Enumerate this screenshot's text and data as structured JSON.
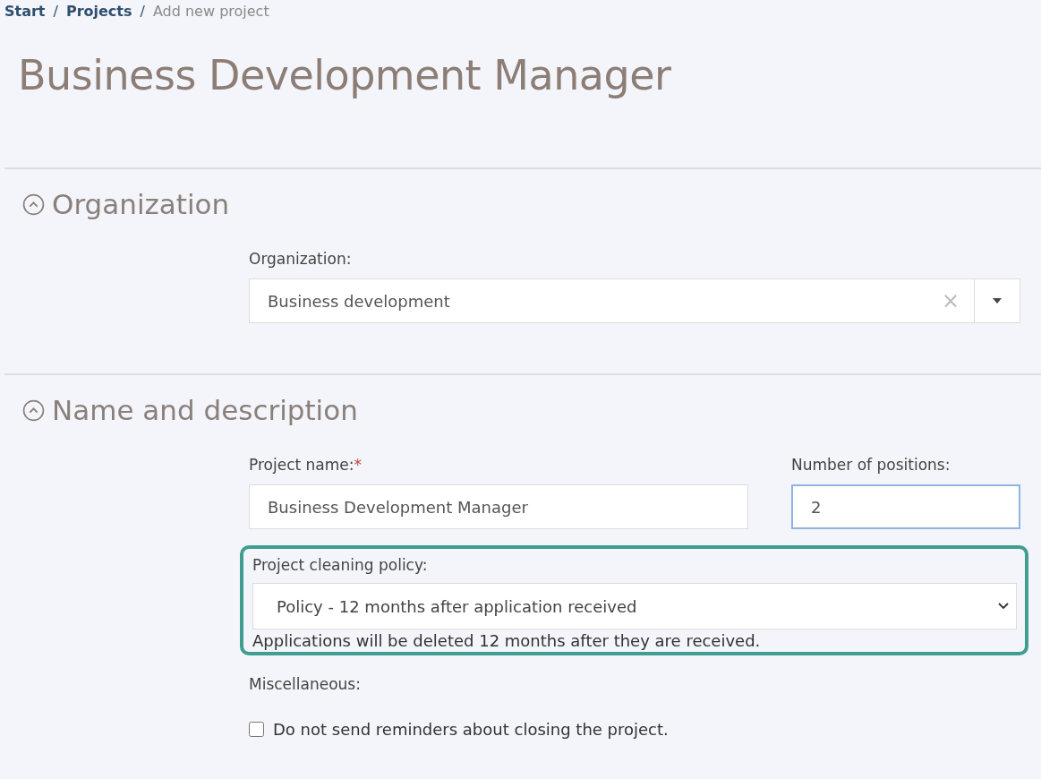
{
  "breadcrumb": [
    {
      "label": "Start",
      "link": true
    },
    {
      "label": "Projects",
      "link": true
    },
    {
      "label": "Add new project",
      "link": false
    }
  ],
  "breadcrumb_separator": "/",
  "page_title": "Business Development Manager",
  "sections": [
    {
      "title": "Organization",
      "expanded": true,
      "kind": "organization",
      "organization": {
        "label": "Organization:",
        "value": "Business development",
        "clear_symbol": "×"
      }
    },
    {
      "title": "Name and description",
      "expanded": true,
      "kind": "name",
      "project_name": {
        "label": "Project name:",
        "required_mark": "*",
        "value": "Business Development Manager",
        "focused": false
      },
      "positions": {
        "label": "Number of positions:",
        "value": "2",
        "focused": true
      },
      "cleaning_policy": {
        "label": "Project cleaning policy:",
        "value": "Policy - 12 months after application received",
        "help": "Applications will be deleted 12 months after they are received.",
        "highlighted": true
      },
      "misc": {
        "label": "Miscellaneous:",
        "options": [
          {
            "label": "Do not send reminders about closing the project.",
            "checked": false
          }
        ]
      }
    }
  ]
}
